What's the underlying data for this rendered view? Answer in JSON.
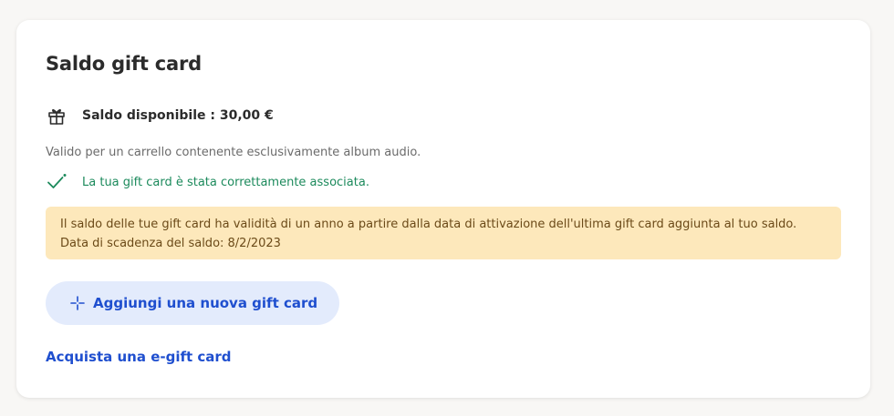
{
  "card": {
    "title": "Saldo gift card",
    "balance_label": "Saldo disponibile : 30,00 €",
    "valid_text": "Valido per un carrello contenente esclusivamente album audio.",
    "success_text": "La tua gift card è stata correttamente associata.",
    "notice_line1": "Il saldo delle tue gift card ha validità di un anno a partire dalla data di attivazione dell'ultima gift card aggiunta al tuo saldo.",
    "notice_line2": "Data di scadenza del saldo: 8/2/2023",
    "add_button_label": "Aggiungi una nuova gift card",
    "buy_link_label": "Acquista una e-gift card"
  },
  "icons": {
    "gift": "gift-icon",
    "check": "check-icon",
    "plus": "plus-icon"
  },
  "colors": {
    "accent": "#1f4fcf",
    "success": "#1c8a5c",
    "notice_bg": "#fde8bb",
    "button_bg": "#e3ebfc"
  }
}
